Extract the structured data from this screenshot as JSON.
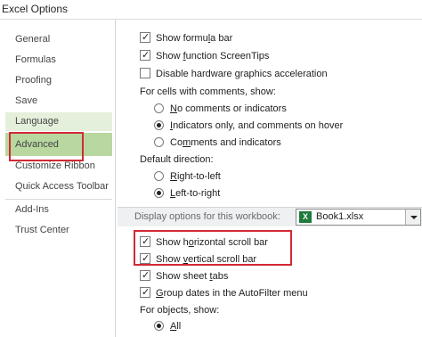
{
  "window": {
    "title": "Excel Options"
  },
  "sidebar": {
    "items": [
      {
        "label": "General"
      },
      {
        "label": "Formulas"
      },
      {
        "label": "Proofing"
      },
      {
        "label": "Save"
      },
      {
        "label": "Language"
      },
      {
        "label": "Advanced",
        "state": "selected"
      },
      {
        "label": "Customize Ribbon"
      },
      {
        "label": "Quick Access Toolbar"
      },
      {
        "label": "Add-Ins"
      },
      {
        "label": "Trust Center"
      }
    ]
  },
  "display": {
    "show_formula_bar": {
      "pre": "Show formu",
      "u": "l",
      "post": "a bar",
      "checked": true
    },
    "show_screentips": {
      "pre": "Show ",
      "u": "f",
      "post": "unction ScreenTips",
      "checked": true
    },
    "disable_hw_accel": {
      "pre": "Disable hardware ",
      "u": "g",
      "post": "raphics acceleration",
      "checked": false
    },
    "comments_heading": "For cells with comments, show:",
    "comments_options": [
      {
        "pre": "",
        "u": "N",
        "post": "o comments or indicators",
        "checked": false
      },
      {
        "pre": "",
        "u": "I",
        "post": "ndicators only, and comments on hover",
        "checked": true
      },
      {
        "pre": "Co",
        "u": "m",
        "post": "ments and indicators",
        "checked": false
      }
    ],
    "direction_heading": "Default direction:",
    "direction_options": [
      {
        "pre": "",
        "u": "R",
        "post": "ight-to-left",
        "checked": false
      },
      {
        "pre": "",
        "u": "L",
        "post": "eft-to-right",
        "checked": true
      }
    ]
  },
  "workbook": {
    "section_label": "Display options for this workbook:",
    "combo_value": "Book1.xlsx",
    "combo_icon": "excel-icon",
    "show_hscroll": {
      "pre": "Show h",
      "u": "o",
      "post": "rizontal scroll bar",
      "checked": true
    },
    "show_vscroll": {
      "pre": "Show ",
      "u": "v",
      "post": "ertical scroll bar",
      "checked": true
    },
    "show_sheet_tabs": {
      "pre": "Show sheet ",
      "u": "t",
      "post": "abs",
      "checked": true
    },
    "group_dates": {
      "pre": "",
      "u": "G",
      "post": "roup dates in the AutoFilter menu",
      "checked": true
    },
    "objects_heading": "For objects, show:",
    "objects_all": {
      "pre": "",
      "u": "A",
      "post": "ll",
      "checked": true
    }
  },
  "annotations": {
    "highlight_color": "#d22a35"
  }
}
